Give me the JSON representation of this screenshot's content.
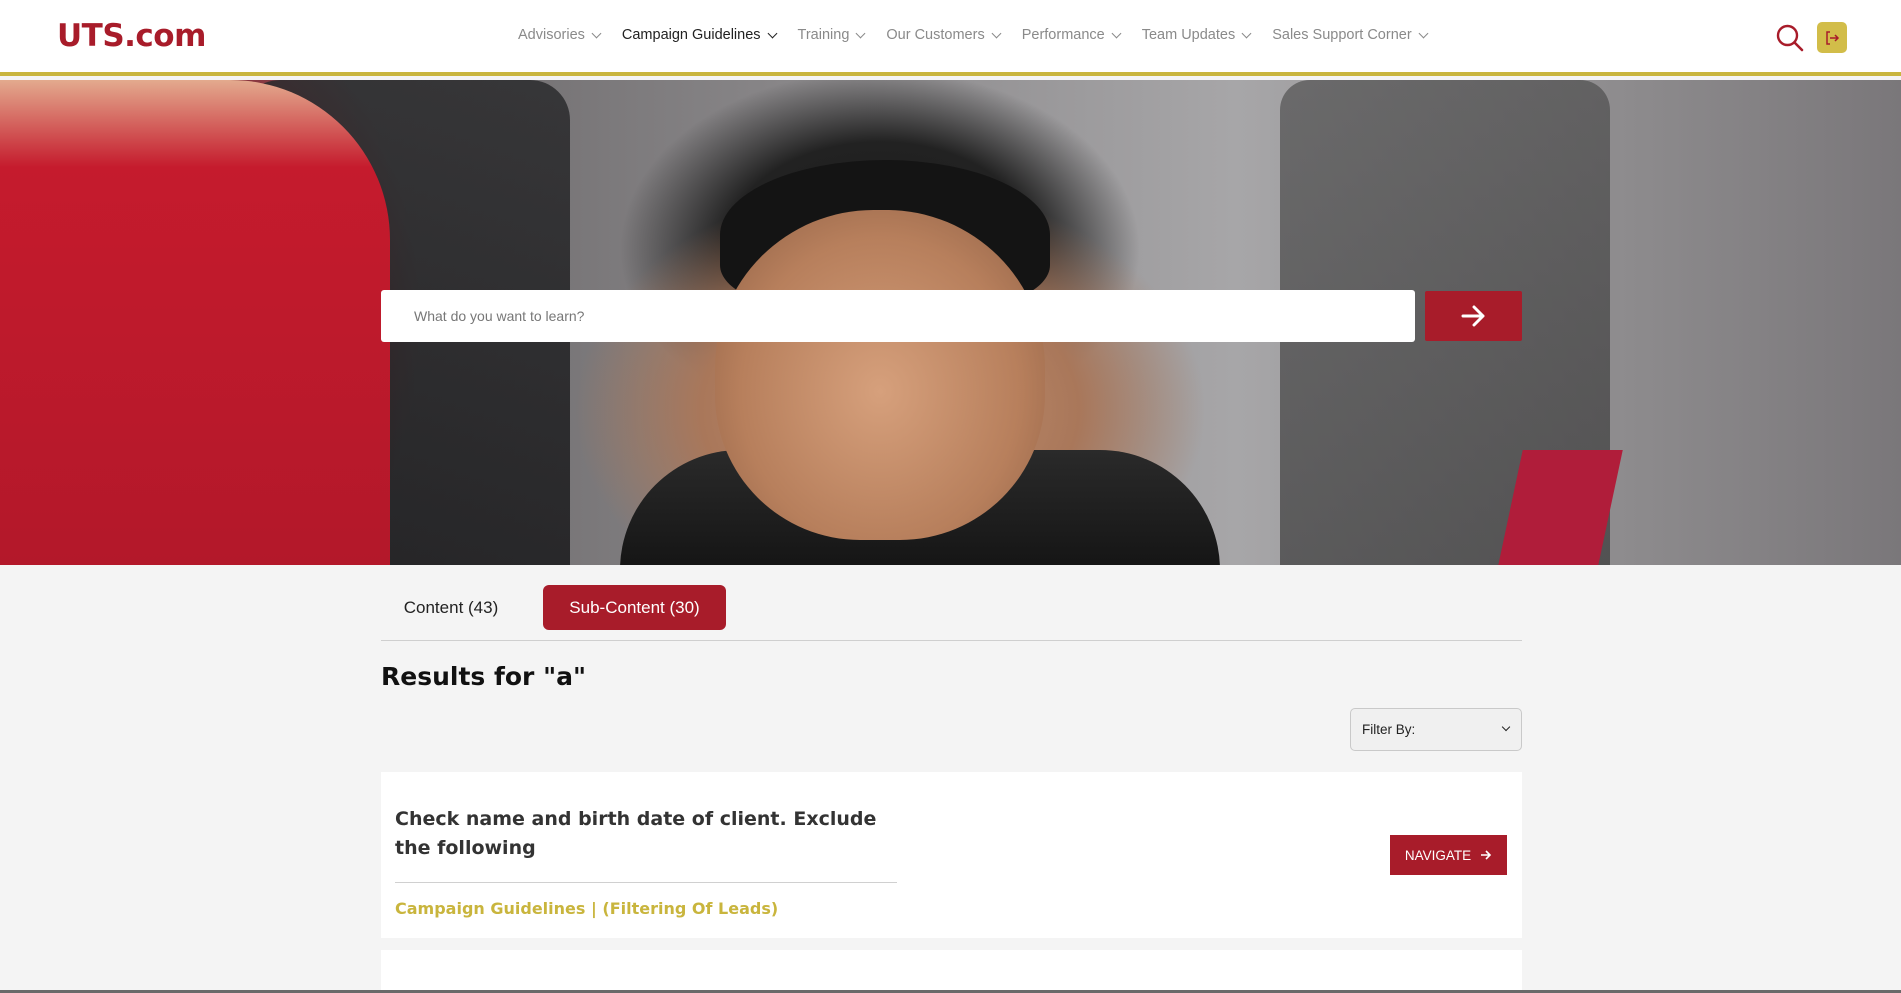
{
  "header": {
    "logo": "UTS.com",
    "nav": [
      {
        "label": "Advisories",
        "active": false
      },
      {
        "label": "Campaign Guidelines",
        "active": true
      },
      {
        "label": "Training",
        "active": false
      },
      {
        "label": "Our Customers",
        "active": false
      },
      {
        "label": "Performance",
        "active": false
      },
      {
        "label": "Team Updates",
        "active": false
      },
      {
        "label": "Sales Support Corner",
        "active": false
      }
    ],
    "search_icon": "search-icon",
    "logout_icon": "logout-icon"
  },
  "hero": {
    "search_placeholder": "What do you want to learn?",
    "search_value": "",
    "submit_icon": "arrow-right-icon"
  },
  "tabs": [
    {
      "label": "Content (43)",
      "active": false
    },
    {
      "label": "Sub-Content (30)",
      "active": true
    }
  ],
  "results": {
    "title": "Results for \"a\"",
    "filter_label": "Filter By:"
  },
  "items": [
    {
      "title": "Check name and birth date of client. Exclude the following",
      "category": "Campaign Guidelines | (Filtering Of Leads)",
      "action": "NAVIGATE"
    }
  ],
  "colors": {
    "brand_red": "#a81c2a",
    "brand_gold": "#c9b53d"
  }
}
